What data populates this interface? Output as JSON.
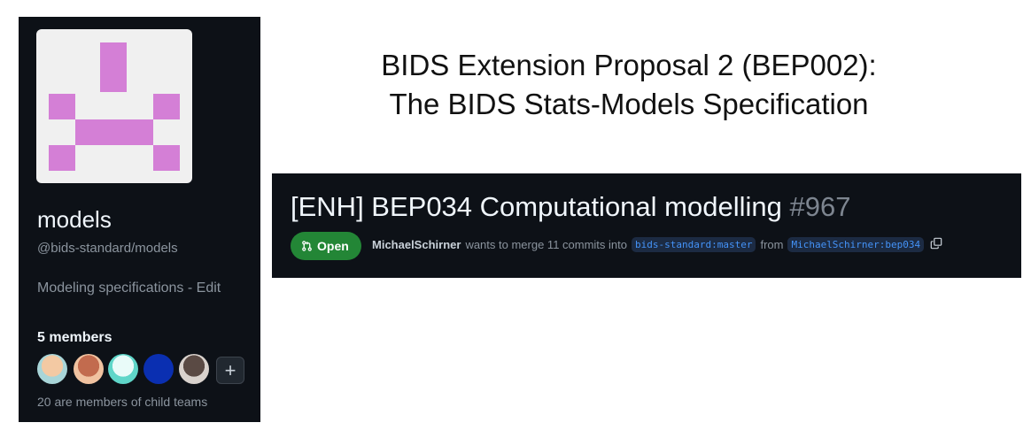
{
  "team": {
    "name": "models",
    "handle": "@bids-standard/models",
    "description": "Modeling specifications",
    "description_separator": " - ",
    "edit_label": "Edit",
    "members_heading": "5 members",
    "child_teams_text": "20 are members of child teams",
    "add_member_label": "+",
    "identicon_color": "#d47fd6",
    "avatars": [
      {
        "name": "member-1",
        "colors": [
          "#f3c9a3",
          "#a8d5d8"
        ]
      },
      {
        "name": "member-2",
        "colors": [
          "#c26b4e",
          "#f0c2a0"
        ]
      },
      {
        "name": "member-3",
        "colors": [
          "#e9fbf9",
          "#5fd6c9"
        ]
      },
      {
        "name": "member-4",
        "colors": [
          "#0a2fb1",
          "#0a2fb1"
        ]
      },
      {
        "name": "member-5",
        "colors": [
          "#5a4a44",
          "#d9d2cd"
        ]
      }
    ]
  },
  "heading": {
    "line1": "BIDS Extension Proposal 2 (BEP002):",
    "line2": "The BIDS Stats-Models Specification"
  },
  "pull_request": {
    "title": "[ENH] BEP034 Computational modelling",
    "number": "#967",
    "state": "Open",
    "author": "MichaelSchirner",
    "action_text": "wants to merge 11 commits into",
    "base_branch": "bids-standard:master",
    "from_text": "from",
    "head_branch": "MichaelSchirner:bep034"
  }
}
